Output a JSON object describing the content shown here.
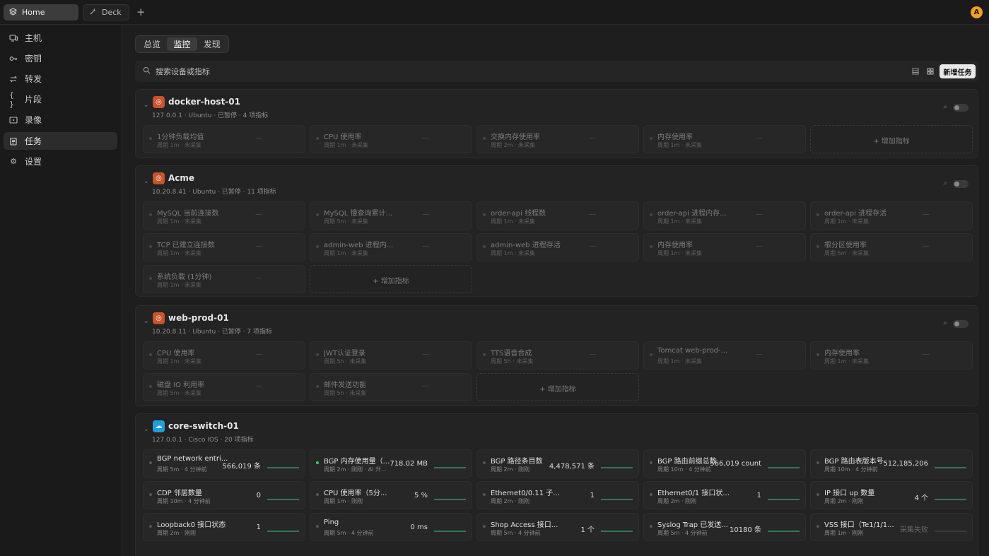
{
  "tabs": [
    {
      "label": "Home",
      "icon": "layers-icon"
    },
    {
      "label": "Deck",
      "icon": "sparkle-icon"
    }
  ],
  "avatar": "A",
  "sidebar": {
    "items": [
      {
        "label": "主机",
        "icon": "monitor-icon"
      },
      {
        "label": "密钥",
        "icon": "key-icon"
      },
      {
        "label": "转发",
        "icon": "swap-icon"
      },
      {
        "label": "片段",
        "icon": "braces-icon"
      },
      {
        "label": "录像",
        "icon": "video-icon"
      },
      {
        "label": "任务",
        "icon": "clipboard-icon",
        "active": true
      },
      {
        "label": "设置",
        "icon": "gear-icon"
      }
    ]
  },
  "segment": [
    "总览",
    "监控",
    "发现"
  ],
  "segment_active": 1,
  "search": {
    "placeholder": "搜索设备或指标"
  },
  "new_task_label": "新增任务",
  "add_metric_label": "增加指标",
  "colors": {
    "accent_green": "#2ecc71",
    "ubuntu": "#c8532c",
    "cisco": "#1b9fe0",
    "avatar": "#f0a020"
  },
  "groups": [
    {
      "name": "docker-host-01",
      "meta": "127.0.0.1 · Ubuntu · 已暂停 · 4 项指标",
      "os": "ubuntu",
      "cards": [
        {
          "name": "1分钟负载均值",
          "meta": "周期 1m · 未采集"
        },
        {
          "name": "CPU 使用率",
          "meta": "周期 1m · 未采集"
        },
        {
          "name": "交换内存使用率",
          "meta": "周期 2m · 未采集"
        },
        {
          "name": "内存使用率",
          "meta": "周期 1m · 未采集"
        }
      ]
    },
    {
      "name": "Acme",
      "meta": "10.20.8.41 · Ubuntu · 已暂停 · 11 项指标",
      "os": "ubuntu",
      "cards": [
        {
          "name": "MySQL 当前连接数",
          "meta": "周期 1m · 未采集"
        },
        {
          "name": "MySQL 慢查询累计...",
          "meta": "周期 5m · 未采集"
        },
        {
          "name": "order-api 线程数",
          "meta": "周期 1m · 未采集"
        },
        {
          "name": "order-api 进程内存...",
          "meta": "周期 1m · 未采集"
        },
        {
          "name": "order-api 进程存活",
          "meta": "周期 1m · 未采集"
        },
        {
          "name": "TCP 已建立连接数",
          "meta": "周期 1m · 未采集"
        },
        {
          "name": "admin-web 进程内...",
          "meta": "周期 1m · 未采集"
        },
        {
          "name": "admin-web 进程存活",
          "meta": "周期 1m · 未采集"
        },
        {
          "name": "内存使用率",
          "meta": "周期 1m · 未采集"
        },
        {
          "name": "根分区使用率",
          "meta": "周期 5m · 未采集"
        },
        {
          "name": "系统负载 (1分钟)",
          "meta": "周期 1m · 未采集"
        }
      ]
    },
    {
      "name": "web-prod-01",
      "meta": "10.20.8.11 · Ubuntu · 已暂停 · 7 项指标",
      "os": "ubuntu",
      "cards": [
        {
          "name": "CPU 使用率",
          "meta": "周期 1m · 未采集"
        },
        {
          "name": "JWT认证登录",
          "meta": "周期 5h · 未采集"
        },
        {
          "name": "TTS语音合成",
          "meta": "周期 5h · 未采集"
        },
        {
          "name": "Tomcat web-prod-...",
          "meta": "周期 1m · 未采集"
        },
        {
          "name": "内存使用率",
          "meta": "周期 1m · 未采集"
        },
        {
          "name": "磁盘 IO 利用率",
          "meta": "周期 5m · 未采集"
        },
        {
          "name": "邮件发送功能",
          "meta": "周期 5h · 未采集"
        }
      ]
    },
    {
      "name": "core-switch-01",
      "meta": "127.0.0.1 · Cisco IOS · 20 项指标",
      "os": "cisco",
      "cards": [
        {
          "name": "BGP network entri...",
          "meta": "周期 5m · 4 分钟前",
          "value": "566,019 条"
        },
        {
          "name": "BGP 内存使用量（...",
          "meta": "周期 2m · 刚刚 · AI 升...",
          "value": "718.02 MB",
          "green": true
        },
        {
          "name": "BGP 路径条目数",
          "meta": "周期 2m · 刚刚",
          "value": "4,478,571 条"
        },
        {
          "name": "BGP 路由前缀总数",
          "meta": "周期 10m · 4 分钟前",
          "value": "566,019 count"
        },
        {
          "name": "BGP 路由表版本号",
          "meta": "周期 10m · 4 分钟前",
          "value": "512,185,206"
        },
        {
          "name": "CDP 邻居数量",
          "meta": "周期 10m · 4 分钟前",
          "value": "0"
        },
        {
          "name": "CPU 使用率（5分...",
          "meta": "周期 1m · 刚刚",
          "value": "5 %"
        },
        {
          "name": "Ethernet0/0.11 子...",
          "meta": "周期 2m · 刚刚",
          "value": "1"
        },
        {
          "name": "Ethernet0/1 接口状...",
          "meta": "周期 2m · 刚刚",
          "value": "1"
        },
        {
          "name": "IP 接口 up 数量",
          "meta": "周期 2m · 刚刚",
          "value": "4 个"
        },
        {
          "name": "Loopback0 接口状态",
          "meta": "周期 2m · 刚刚",
          "value": "1"
        },
        {
          "name": "Ping",
          "meta": "周期 5m · 4 分钟前",
          "value": "0 ms"
        },
        {
          "name": "Shop Access 接口...",
          "meta": "周期 5m · 4 分钟前",
          "value": "1 个"
        },
        {
          "name": "Syslog Trap 已发送...",
          "meta": "周期 5m · 4 分钟前",
          "value": "10180 条"
        },
        {
          "name": "VSS 接口（Te1/1/1...",
          "meta": "周期 1m · 刚刚",
          "value": "采集失败",
          "failed": true
        }
      ]
    }
  ]
}
